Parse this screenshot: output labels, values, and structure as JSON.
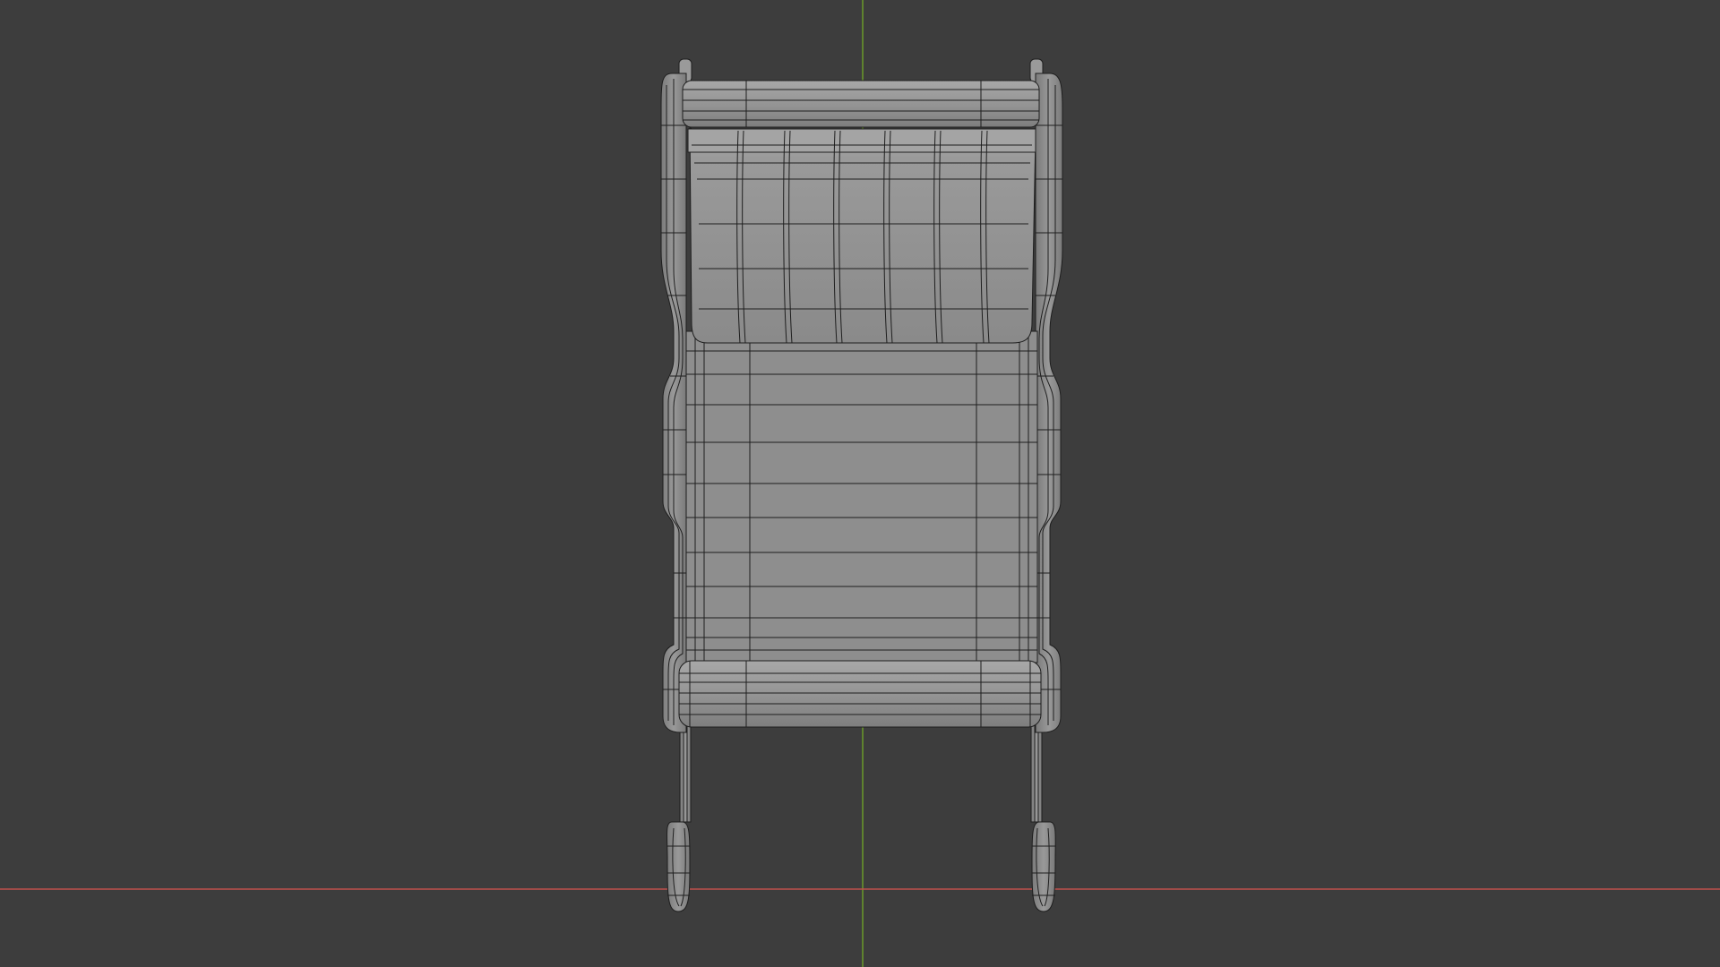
{
  "viewport": {
    "background_color": "#3d3d3d",
    "mesh_fill_color": "#8c8c8c",
    "mesh_light_color": "#a3a3a3",
    "wire_color": "#1e1e1e",
    "x_axis_color": "#c0504d",
    "y_axis_color": "#6a9a2a",
    "object": "mesh-wireframe-chair"
  }
}
